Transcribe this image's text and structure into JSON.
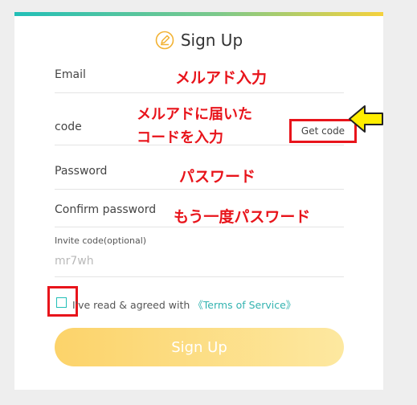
{
  "form": {
    "title": "Sign Up",
    "title_icon": "pencil-icon",
    "email_label": "Email",
    "code_label": "code",
    "get_code_label": "Get code",
    "password_label": "Password",
    "confirm_password_label": "Confirm password",
    "invite_label": "Invite code(optional)",
    "invite_value": "mr7wh",
    "agree_text": "I've read & agreed with ",
    "terms_link": "《Terms of Service》",
    "submit_label": "Sign Up"
  },
  "annotations": {
    "email_note": "メルアド入力",
    "code_note_line1": "メルアドに届いた",
    "code_note_line2": "コードを入力",
    "password_note": "パスワード",
    "confirm_note": "もう一度パスワード",
    "arrow_icon": "arrow-left-icon"
  },
  "colors": {
    "accent_teal": "#22bfb7",
    "accent_yellow": "#f5d13c",
    "annotation_red": "#e8141b",
    "button_yellow": "#fcd36a",
    "arrow_yellow": "#ffee00"
  }
}
